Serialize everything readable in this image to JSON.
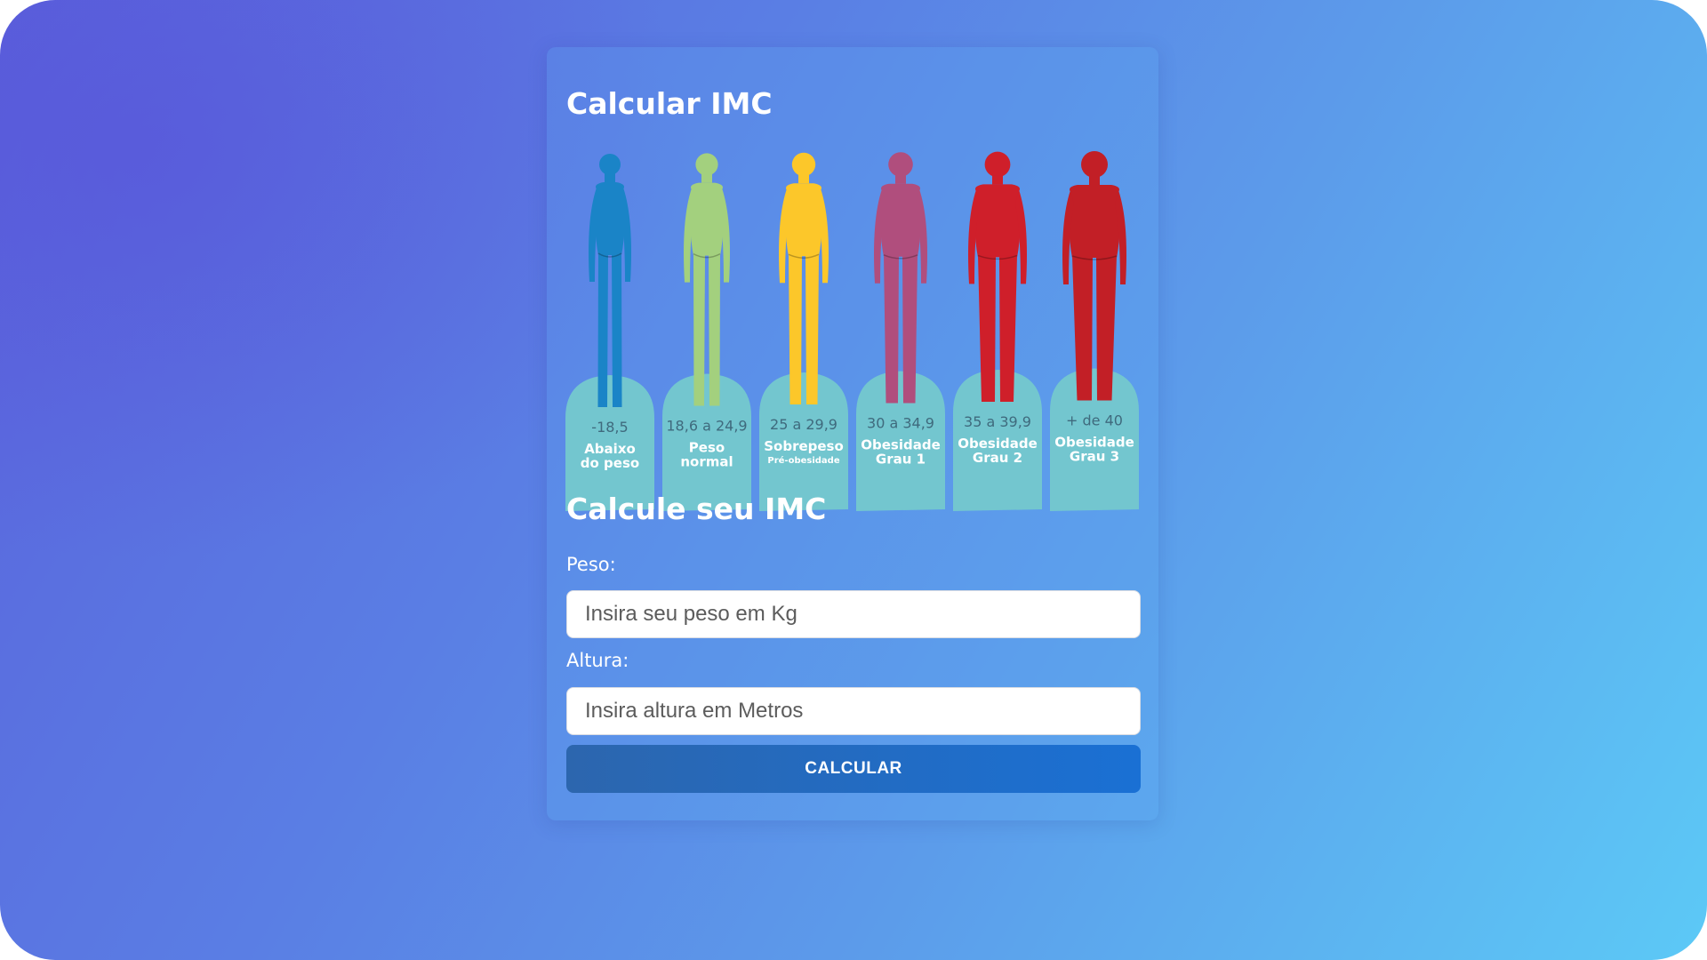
{
  "page": {
    "title": "Calcular IMC",
    "subtitle": "Calcule seu IMC"
  },
  "bmi_categories": [
    {
      "range": "-18,5",
      "label_line1": "Abaixo",
      "label_line2": "do peso",
      "sub": "",
      "color": "#1a84c7"
    },
    {
      "range": "18,6 a 24,9",
      "label_line1": "Peso",
      "label_line2": "normal",
      "sub": "",
      "color": "#a3d07e"
    },
    {
      "range": "25 a 29,9",
      "label_line1": "Sobrepeso",
      "label_line2": "",
      "sub": "Pré-obesidade",
      "color": "#fcc72a"
    },
    {
      "range": "30 a 34,9",
      "label_line1": "Obesidade",
      "label_line2": "Grau 1",
      "sub": "",
      "color": "#b04e7d"
    },
    {
      "range": "35 a 39,9",
      "label_line1": "Obesidade",
      "label_line2": "Grau 2",
      "sub": "",
      "color": "#cf1f2a"
    },
    {
      "range": "+ de 40",
      "label_line1": "Obesidade",
      "label_line2": "Grau 3",
      "sub": "",
      "color": "#c21f26"
    }
  ],
  "form": {
    "peso_label": "Peso:",
    "peso_placeholder": "Insira seu peso em Kg",
    "altura_label": "Altura:",
    "altura_placeholder": "Insira altura em Metros",
    "submit_label": "CALCULAR"
  },
  "colors": {
    "tombstone": "#73c6cf",
    "button": "#1a70d4",
    "background_start": "#5a62dc",
    "background_end": "#5cc9f6"
  }
}
